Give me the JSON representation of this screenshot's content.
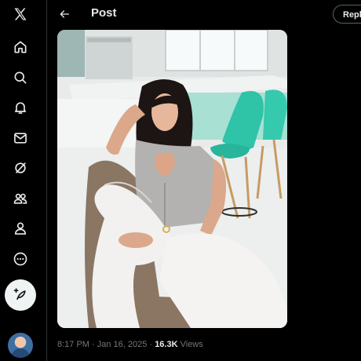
{
  "nav": {
    "items": [
      {
        "name": "x-logo-icon"
      },
      {
        "name": "home-icon"
      },
      {
        "name": "explore-icon"
      },
      {
        "name": "notifications-icon"
      },
      {
        "name": "messages-icon"
      },
      {
        "name": "grok-icon"
      },
      {
        "name": "communities-icon"
      },
      {
        "name": "profile-icon"
      },
      {
        "name": "more-icon"
      }
    ],
    "compose_icon": "compose-post-icon"
  },
  "header": {
    "title": "Post",
    "reply_label": "Repl"
  },
  "post": {
    "time": "8:17 PM",
    "separator": "·",
    "date": "Jan 16, 2025",
    "views_count": "16.3K",
    "views_label": "Views"
  },
  "colors": {
    "background": "#000000",
    "text": "#e7e9ea",
    "muted": "#71767b",
    "divider": "#2f3336"
  }
}
